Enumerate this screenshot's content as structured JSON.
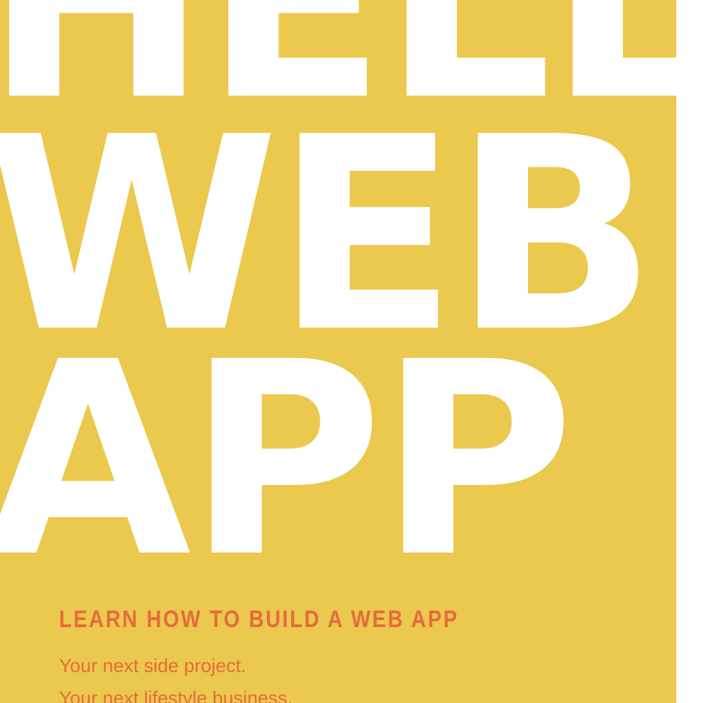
{
  "cover": {
    "background_color": "#ebc84e",
    "headline_color": "#ffffff",
    "accent_color": "#e66b3c",
    "headline_lines": [
      "HELLO",
      "WEB",
      "APP"
    ],
    "subtitle": "LEARN HOW TO BUILD A WEB APP",
    "taglines": [
      "Your next side project.",
      "Your next lifestyle business."
    ]
  }
}
